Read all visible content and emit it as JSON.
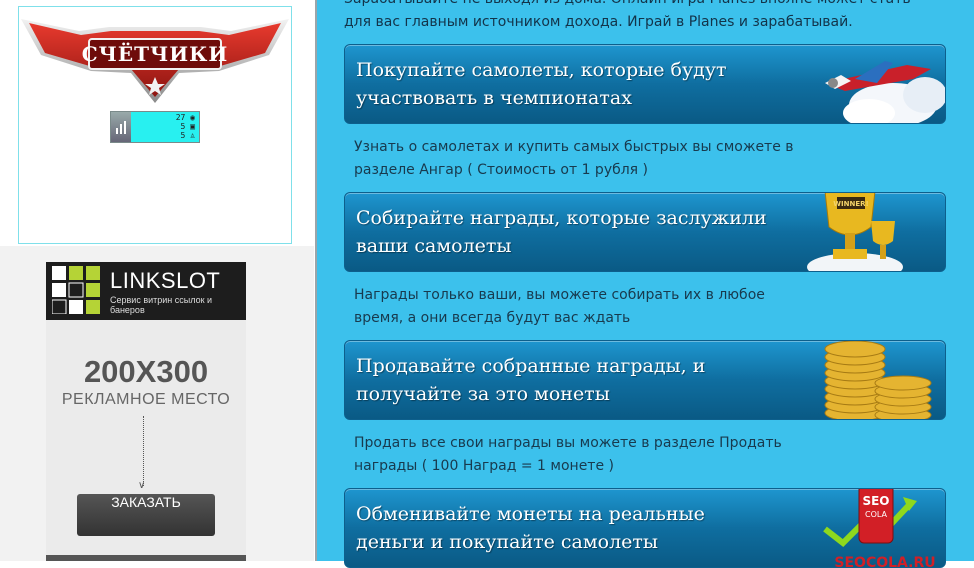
{
  "sidebar": {
    "counters_logo_text": "СЧЁТЧИКИ",
    "counter_widget": {
      "views": "27",
      "hosts": "5",
      "online": "5"
    }
  },
  "ad": {
    "brand": "LINKSLOT",
    "tagline": "Сервис витрин ссылок и банеров",
    "size": "200X300",
    "caption": "РЕКЛАМНОЕ МЕСТО",
    "button_label": "ЗАКАЗАТЬ"
  },
  "main": {
    "intro_lines": [
      "Зарабатывайте не выходя из дома. Онлайн игра Planes вполне может стать",
      "для вас главным источником дохода. Играй в Planes и зарабатывай."
    ],
    "cards": [
      {
        "title_lines": [
          "Покупайте самолеты, которые будут",
          "участвовать в чемпионатах"
        ],
        "art": "airplane-icon"
      },
      {
        "title_lines": [
          "Собирайте награды, которые заслужили",
          "ваши самолеты"
        ],
        "art": "trophy-icon"
      },
      {
        "title_lines": [
          "Продавайте собранные награды, и",
          "получайте за это монеты"
        ],
        "art": "coins-icon"
      },
      {
        "title_lines": [
          "Обменивайте монеты на реальные",
          "деньги и покупайте самолеты"
        ],
        "art": "seocola-icon"
      }
    ],
    "descriptions": [
      [
        "Узнать о самолетах и купить самых быстрых вы сможете в",
        "разделе Ангар ( Стоимость от 1 рубля )"
      ],
      [
        "Награды только ваши, вы можете собирать их в любое",
        "время, а они всегда будут вас ждать"
      ],
      [
        "Продать все свои награды вы можете в разделе Продать",
        "награды ( 100 Наград = 1 монете )"
      ]
    ],
    "seocola_brand": "SEO",
    "seocola_sub": "COLA",
    "seocola_url": "SEOCOLA.RU"
  },
  "colors": {
    "main_bg": "#3cc1ec",
    "card_top": "#1e96cf",
    "card_bottom": "#0a5a85"
  }
}
